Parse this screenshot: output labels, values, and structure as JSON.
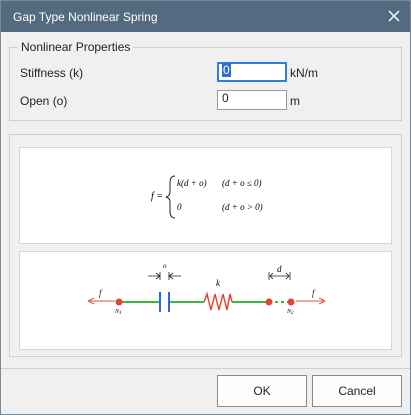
{
  "window": {
    "title": "Gap Type Nonlinear Spring"
  },
  "properties": {
    "legend": "Nonlinear Properties",
    "stiffness": {
      "label": "Stiffness (k)",
      "value": "0",
      "unit": "kN/m"
    },
    "open": {
      "label": "Open (o)",
      "value": "0",
      "unit": "m"
    }
  },
  "formula": {
    "lhs": "f =",
    "case1_expr": "k(d + o)",
    "case1_cond": "(d + o ≤ 0)",
    "case2_expr": "0",
    "case2_cond": "(d + o > 0)"
  },
  "diagram": {
    "force_left": "f",
    "force_right": "f",
    "open_label": "o",
    "stiffness_label": "k",
    "disp_label": "d",
    "node1": "N",
    "node1_sub": "1",
    "node2": "N",
    "node2_sub": "2",
    "colors": {
      "element": "#3cb93c",
      "gap": "#2a6ad8",
      "spring": "#e0453a",
      "node": "#e0453a",
      "force": "#e05a4a"
    }
  },
  "buttons": {
    "ok": "OK",
    "cancel": "Cancel"
  },
  "icons": {
    "close": "close-icon"
  }
}
